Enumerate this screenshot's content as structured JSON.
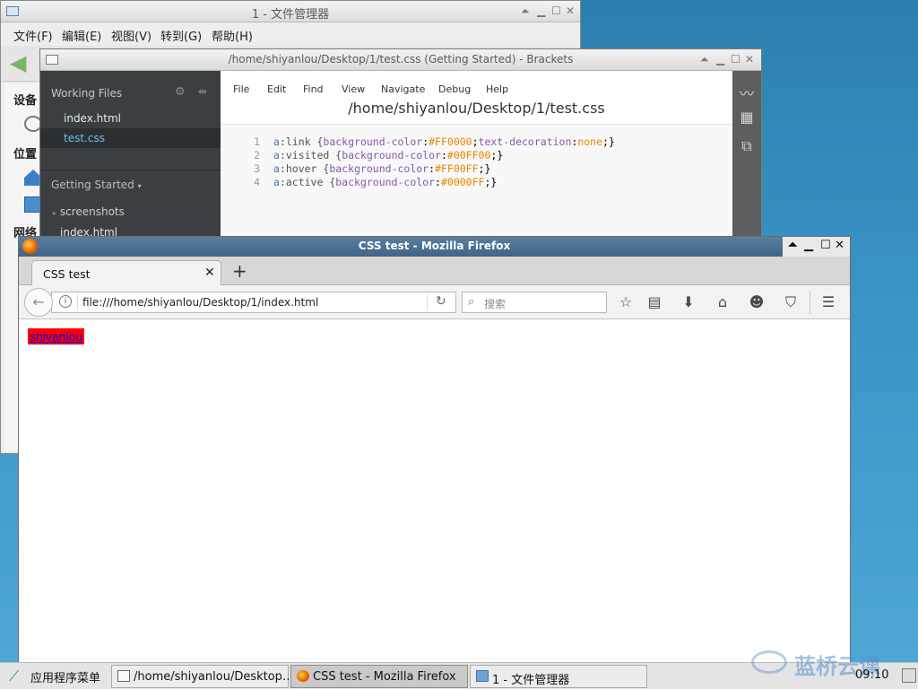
{
  "file_manager": {
    "title": "1 - 文件管理器",
    "menu": [
      "文件(F)",
      "编辑(E)",
      "视图(V)",
      "转到(G)",
      "帮助(H)"
    ],
    "sidebar": {
      "devices": "设备",
      "places": "位置",
      "network": "网络"
    }
  },
  "brackets": {
    "title": "/home/shiyanlou/Desktop/1/test.css (Getting Started) - Brackets",
    "working_files_header": "Working Files",
    "working_files": [
      "index.html",
      "test.css"
    ],
    "project_header": "Getting Started",
    "tree": [
      "screenshots",
      "index.html"
    ],
    "menu": [
      "File",
      "Edit",
      "Find",
      "View",
      "Navigate",
      "Debug",
      "Help"
    ],
    "file_path": "/home/shiyanlou/Desktop/1/test.css",
    "code": [
      {
        "num": "1",
        "sel": "a",
        "pseudo": ":link",
        "decls": [
          {
            "prop": "background-color",
            "val": "#FF0000"
          },
          {
            "prop": "text-decoration",
            "val": "none"
          }
        ]
      },
      {
        "num": "2",
        "sel": "a",
        "pseudo": ":visited",
        "decls": [
          {
            "prop": "background-color",
            "val": "#00FF00"
          }
        ]
      },
      {
        "num": "3",
        "sel": "a",
        "pseudo": ":hover",
        "decls": [
          {
            "prop": "background-color",
            "val": "#FF00FF"
          }
        ]
      },
      {
        "num": "4",
        "sel": "a",
        "pseudo": ":active",
        "decls": [
          {
            "prop": "background-color",
            "val": "#0000FF"
          }
        ]
      }
    ]
  },
  "firefox": {
    "title": "CSS test - Mozilla Firefox",
    "tab_label": "CSS test",
    "url": "file:///home/shiyanlou/Desktop/1/index.html",
    "search_placeholder": "搜索",
    "page_link_text": "shiyanlou",
    "link_bg_color": "#ff0000",
    "link_text_color": "#0000ee"
  },
  "taskbar": {
    "start_label": "应用程序菜单",
    "tasks": [
      {
        "label": "/home/shiyanlou/Desktop…",
        "active": false
      },
      {
        "label": "CSS test - Mozilla Firefox",
        "active": true
      },
      {
        "label": "1 - 文件管理器",
        "active": false
      }
    ],
    "watermark": "蓝桥云课",
    "clock": "09:10"
  }
}
